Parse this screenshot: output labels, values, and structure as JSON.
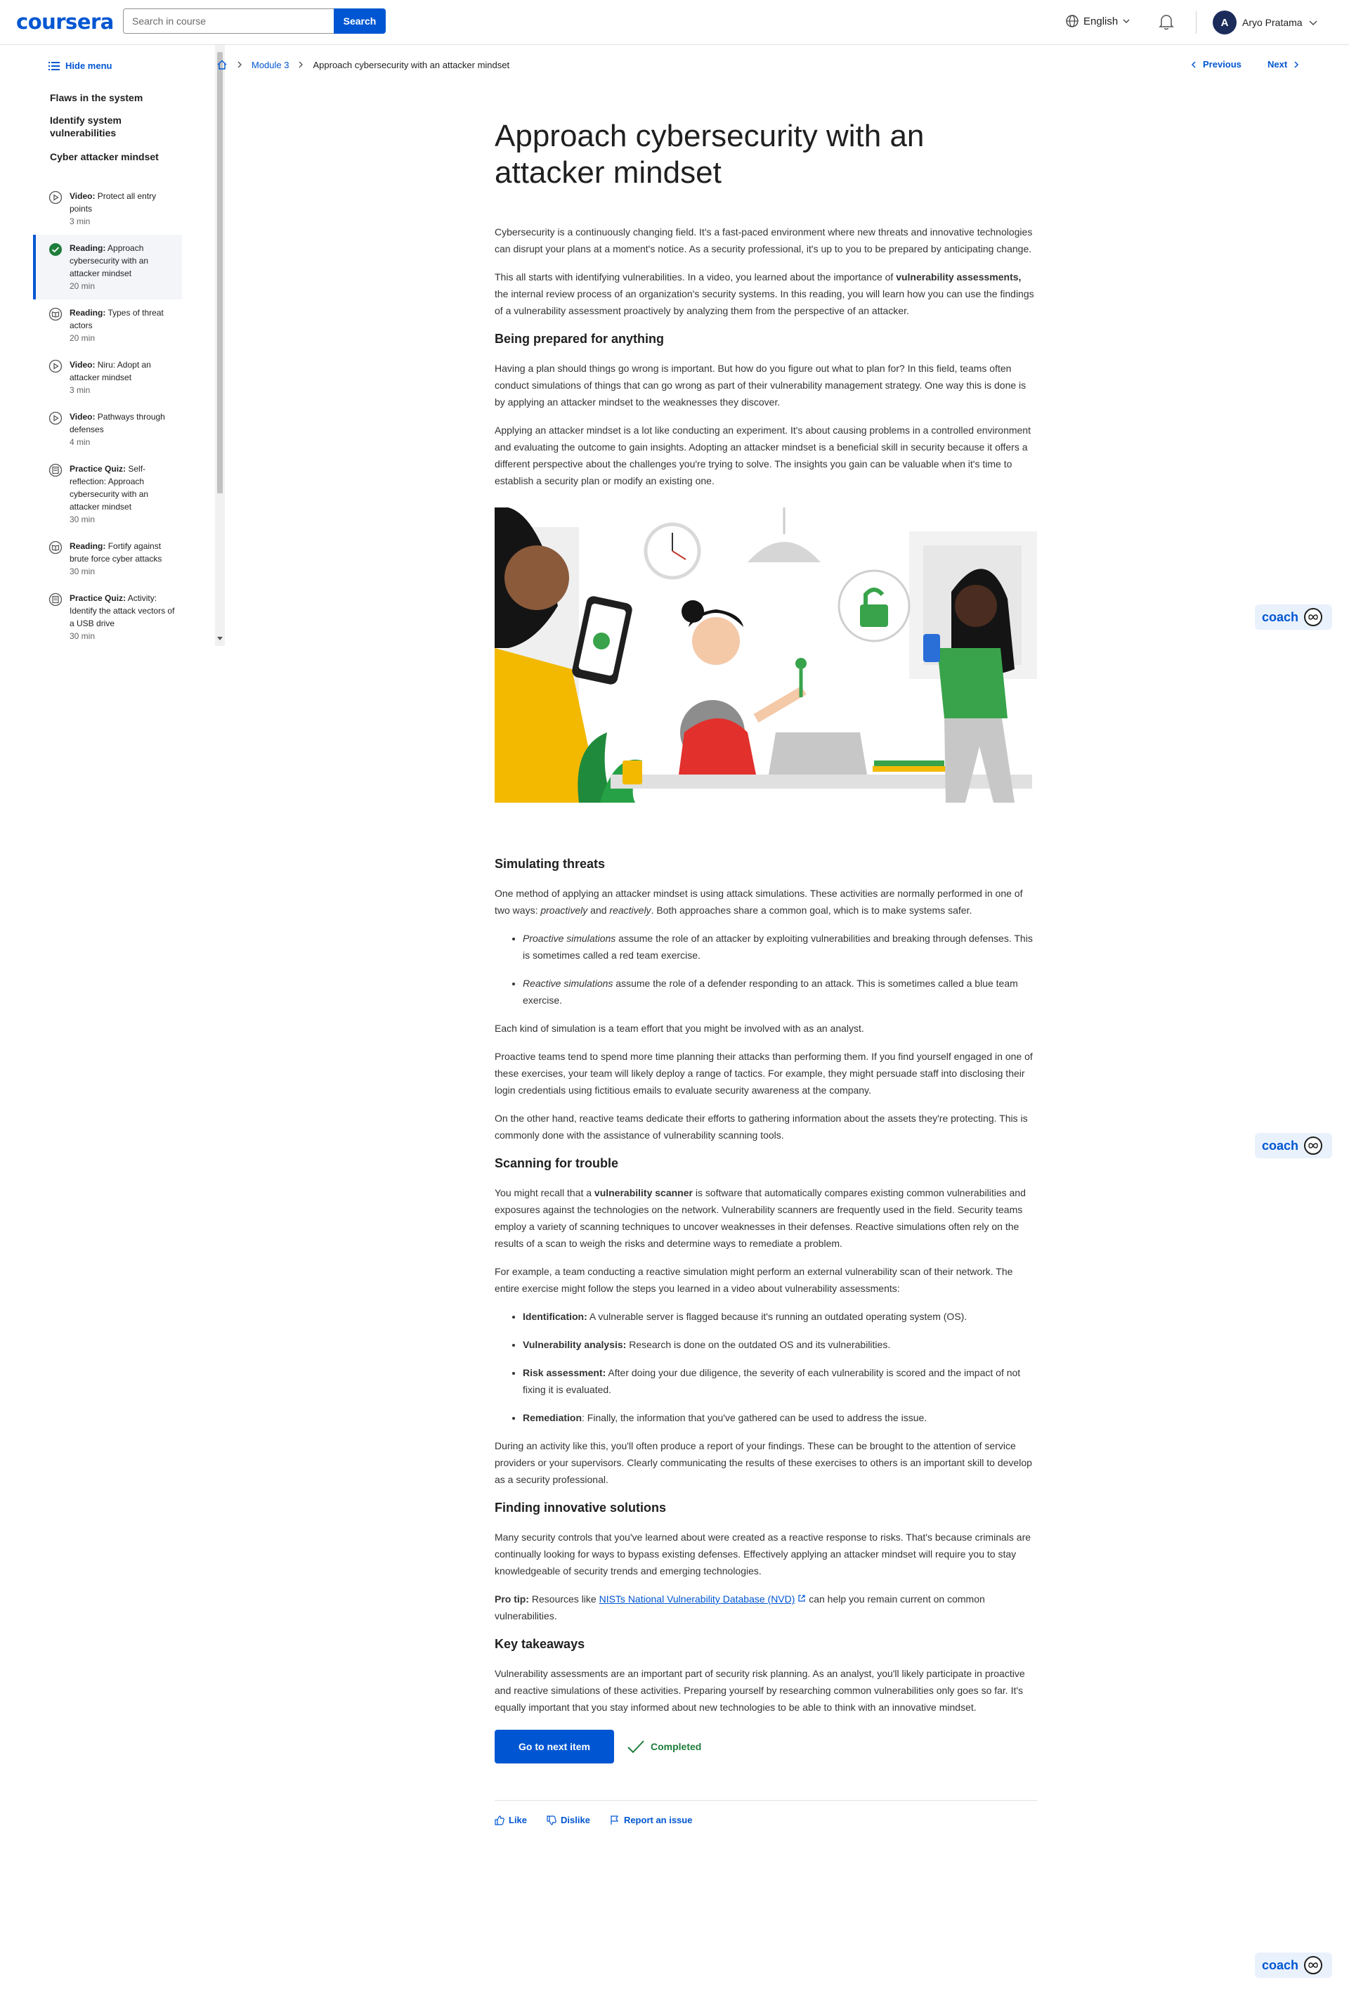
{
  "header": {
    "logo": "coursera",
    "search_placeholder": "Search in course",
    "search_button": "Search",
    "language": "English",
    "user_initial": "A",
    "user_name": "Aryo Pratama"
  },
  "sidebar": {
    "hide_menu": "Hide menu",
    "sections": [
      "Flaws in the system",
      "Identify system vulnerabilities",
      "Cyber attacker mindset"
    ],
    "items": [
      {
        "type": "Video:",
        "title": "Protect all entry points",
        "duration": "3 min",
        "icon": "play-icon"
      },
      {
        "type": "Reading:",
        "title": "Approach cybersecurity with an attacker mindset",
        "duration": "20 min",
        "icon": "check-complete-icon",
        "active": true
      },
      {
        "type": "Reading:",
        "title": "Types of threat actors",
        "duration": "20 min",
        "icon": "reading-icon"
      },
      {
        "type": "Video:",
        "title": "Niru: Adopt an attacker mindset",
        "duration": "3 min",
        "icon": "play-icon"
      },
      {
        "type": "Video:",
        "title": "Pathways through defenses",
        "duration": "4 min",
        "icon": "play-icon"
      },
      {
        "type": "Practice Quiz:",
        "title": "Self-reflection: Approach cybersecurity with an attacker mindset",
        "duration": "30 min",
        "icon": "quiz-icon"
      },
      {
        "type": "Reading:",
        "title": "Fortify against brute force cyber attacks",
        "duration": "30 min",
        "icon": "reading-icon"
      },
      {
        "type": "Practice Quiz:",
        "title": "Activity: Identify the attack vectors of a USB drive",
        "duration": "30 min",
        "icon": "quiz-icon"
      }
    ]
  },
  "breadcrumb": {
    "module": "Module 3",
    "current": "Approach cybersecurity with an attacker mindset"
  },
  "pager": {
    "previous": "Previous",
    "next": "Next"
  },
  "article": {
    "title": "Approach cybersecurity with an attacker mindset",
    "intro1": "Cybersecurity is a continuously changing field. It's a fast-paced environment where new threats and innovative technologies can disrupt your plans at a moment's notice. As a security professional, it's up to you to be prepared by anticipating change.",
    "intro2_a": "This all starts with identifying vulnerabilities. In a video, you learned about the importance of ",
    "intro2_b": "vulnerability assessments,",
    "intro2_c": " the internal review process of an organization's security systems. In this reading, you will learn how you can use the findings of a vulnerability assessment proactively by analyzing them from the perspective of an attacker.",
    "h_prepared": "Being prepared for anything",
    "prepared1": "Having a plan should things go wrong is important. But how do you figure out what to plan for? In this field, teams often conduct simulations of things that can go wrong as part of their vulnerability management strategy. One way this is done is by applying an attacker mindset to the weaknesses they discover.",
    "prepared2": "Applying an attacker mindset is a lot like conducting an experiment. It's about causing problems in a controlled environment and evaluating the outcome to gain insights. Adopting an attacker mindset is a beneficial skill in security because it offers a different perspective about the challenges you're trying to solve. The insights you gain can be valuable when it's time to establish a security plan or modify an existing one.",
    "h_sim": "Simulating threats",
    "sim1_a": "One method of applying an attacker mindset is using attack simulations. These activities are normally performed in one of two ways: ",
    "sim1_b": "proactively",
    "sim1_c": " and ",
    "sim1_d": "reactively",
    "sim1_e": ". Both approaches share a common goal, which is to make systems safer.",
    "sim_b1_em": "Proactive simulations",
    "sim_b1": " assume the role of an attacker by exploiting vulnerabilities and breaking through defenses. This is sometimes called a red team exercise.",
    "sim_b2_em": "Reactive simulations",
    "sim_b2": " assume the role of a defender responding to an attack. This is sometimes called a blue team exercise.",
    "sim2": "Each kind of simulation is a team effort that you might be involved with as an analyst.",
    "sim3": "Proactive teams tend to spend more time planning their attacks than performing them. If you find yourself engaged in one of these exercises, your team will likely deploy a range of tactics. For example, they might persuade staff into disclosing their login credentials using fictitious emails to evaluate security awareness at the company.",
    "sim4": "On the other hand, reactive teams dedicate their efforts to gathering information about the assets they're protecting. This is commonly done with the assistance of vulnerability scanning tools.",
    "h_scan": "Scanning for trouble",
    "scan1_a": "You might recall that a ",
    "scan1_b": "vulnerability scanner",
    "scan1_c": " is software that automatically compares existing common vulnerabilities and exposures against the technologies on the network. Vulnerability scanners are frequently used in the field. Security teams employ a variety of scanning techniques to uncover weaknesses in their defenses. Reactive simulations often rely on the results of a scan to weigh the risks and determine ways to remediate a problem.",
    "scan2": "For example, a team conducting a reactive simulation might perform an external vulnerability scan of their network. The entire exercise might follow the steps you learned in a video about vulnerability assessments:",
    "scan_b1_k": "Identification:",
    "scan_b1": " A vulnerable server is flagged because it's running an outdated operating system (OS).",
    "scan_b2_k": "Vulnerability analysis:",
    "scan_b2": " Research is done on the outdated OS and its vulnerabilities.",
    "scan_b3_k": "Risk assessment:",
    "scan_b3": " After doing your due diligence, the severity of each vulnerability is scored and the impact of not fixing it is evaluated.",
    "scan_b4_k": "Remediation",
    "scan_b4": ": Finally, the information that you've gathered can be used to address the issue.",
    "scan3": "During an activity like this, you'll often produce a report of your findings. These can be brought to the attention of service providers or your supervisors. Clearly communicating the results of these exercises to others is an important skill to develop as a security professional.",
    "h_find": "Finding innovative solutions",
    "find1": "Many security controls that you've learned about were created as a reactive response to risks. That's because criminals are continually looking for ways to bypass existing defenses. Effectively applying an attacker mindset will require you to stay knowledgeable of security trends and emerging technologies.",
    "find2_k": "Pro tip:",
    "find2_a": " Resources like ",
    "find2_link": "NISTs National Vulnerability Database (NVD)",
    "find2_b": " can help you remain current on common vulnerabilities.",
    "h_key": "Key takeaways",
    "key1": "Vulnerability assessments are an important part of security risk planning. As an analyst, you'll likely participate in proactive and reactive simulations of these activities. Preparing yourself by researching common vulnerabilities only goes so far. It's equally important that you stay informed about new technologies to be able to think with an innovative mindset."
  },
  "actions": {
    "next_item": "Go to next item",
    "completed": "Completed",
    "like": "Like",
    "dislike": "Dislike",
    "report": "Report an issue"
  },
  "coach_label": "coach",
  "colors": {
    "brand": "#0056d2",
    "success": "#1e7d3a"
  }
}
